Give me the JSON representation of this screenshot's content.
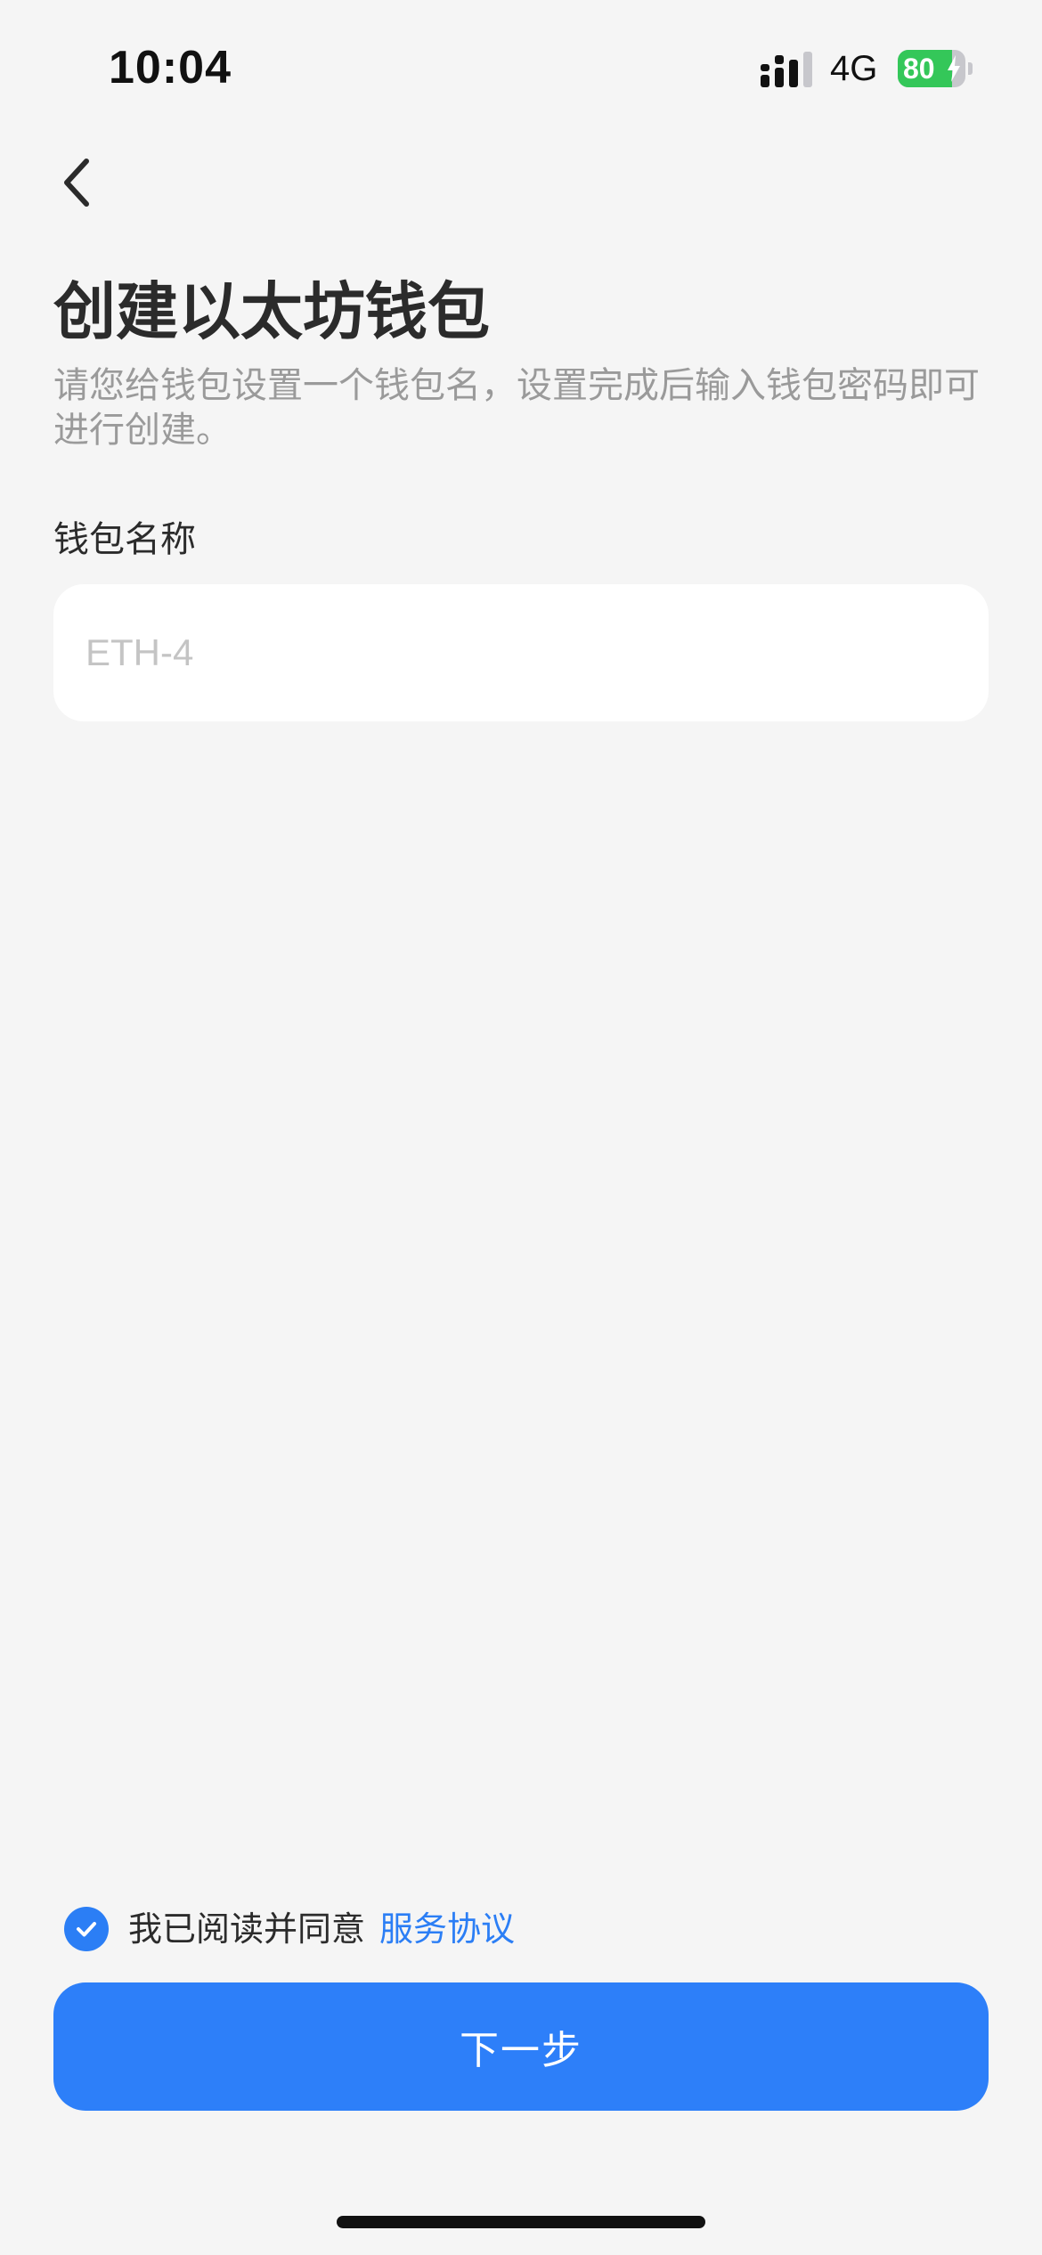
{
  "status_bar": {
    "time": "10:04",
    "network": "4G",
    "battery_level": "80",
    "battery_fraction": 0.8
  },
  "header": {
    "back_icon": "chevron-left-icon"
  },
  "main": {
    "title": "创建以太坊钱包",
    "subtitle": "请您给钱包设置一个钱包名，设置完成后输入钱包密码即可进行创建。",
    "wallet_name": {
      "label": "钱包名称",
      "placeholder": "ETH-4",
      "value": ""
    }
  },
  "agreement": {
    "checked": true,
    "text": "我已阅读并同意",
    "link_label": "服务协议"
  },
  "footer": {
    "next_label": "下一步"
  },
  "colors": {
    "background": "#f5f5f5",
    "accent": "#2d7ff9",
    "battery_green": "#34c759"
  }
}
